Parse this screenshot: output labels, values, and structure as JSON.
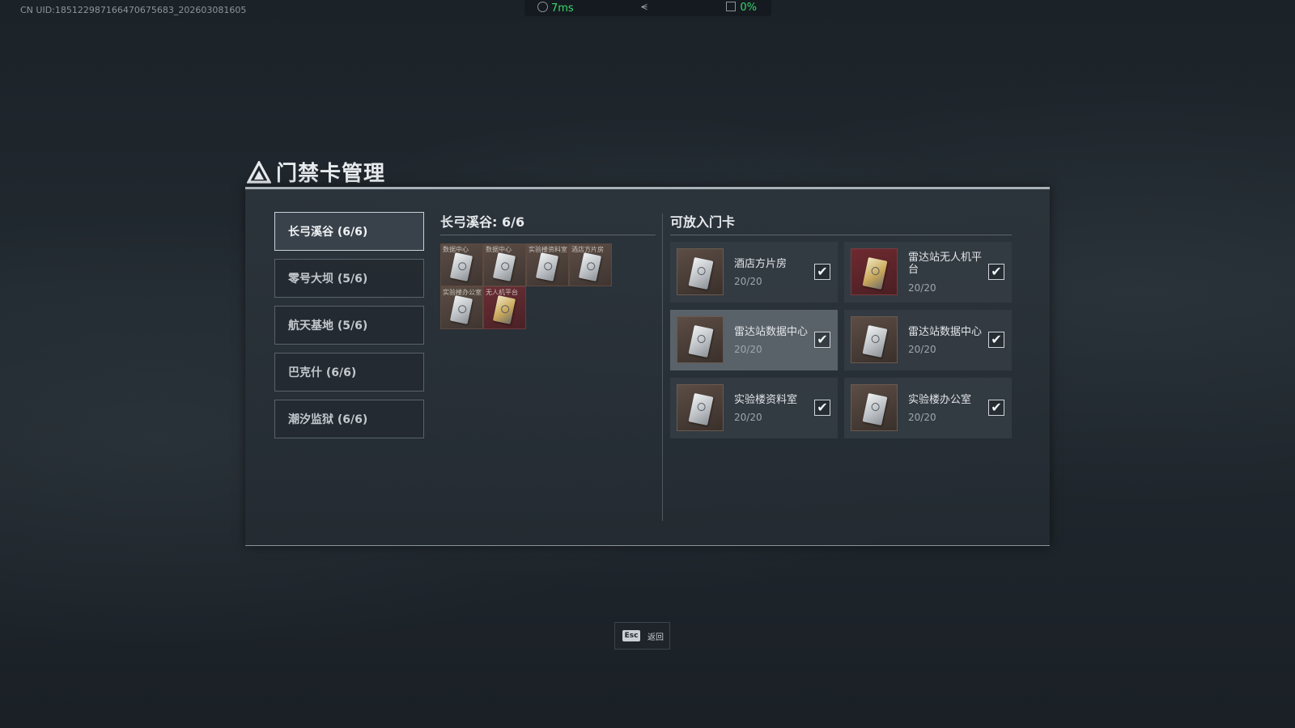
{
  "overlay": {
    "uid": "CN UID:1851229871664706756​83_202603081605",
    "ping": "7ms",
    "loss": "0%",
    "expand_icon": "chevron-double-down-icon"
  },
  "panel": {
    "title": "门禁卡管理",
    "title_icon": "warning-triangle-icon"
  },
  "regions": [
    {
      "label": "长弓溪谷 (6/6)",
      "active": true
    },
    {
      "label": "零号大坝 (5/6)",
      "active": false
    },
    {
      "label": "航天基地 (5/6)",
      "active": false
    },
    {
      "label": "巴克什 (6/6)",
      "active": false
    },
    {
      "label": "潮汐监狱 (6/6)",
      "active": false
    }
  ],
  "slots": {
    "heading": "长弓溪谷: 6/6",
    "items": [
      {
        "label": "数据中心",
        "type": "silver"
      },
      {
        "label": "数据中心",
        "type": "silver"
      },
      {
        "label": "实验楼资料室",
        "type": "silver"
      },
      {
        "label": "酒店方片房",
        "type": "silver"
      },
      {
        "label": "实验楼办公室",
        "type": "silver"
      },
      {
        "label": "无人机平台",
        "type": "gold"
      }
    ]
  },
  "available": {
    "heading": "可放入门卡",
    "cards": [
      {
        "name": "酒店方片房",
        "count": "20/20",
        "checked": true,
        "thumb": "brown",
        "highlight": false
      },
      {
        "name": "雷达站无人机平台",
        "count": "20/20",
        "checked": true,
        "thumb": "red",
        "highlight": false
      },
      {
        "name": "雷达站数据中心",
        "count": "20/20",
        "checked": true,
        "thumb": "brown",
        "highlight": true
      },
      {
        "name": "雷达站数据中心",
        "count": "20/20",
        "checked": true,
        "thumb": "brown",
        "highlight": false
      },
      {
        "name": "实验楼资料室",
        "count": "20/20",
        "checked": true,
        "thumb": "brown",
        "highlight": false
      },
      {
        "name": "实验楼办公室",
        "count": "20/20",
        "checked": true,
        "thumb": "brown",
        "highlight": false
      }
    ]
  },
  "footer": {
    "esc_key": "Esc",
    "esc_label": "返回"
  }
}
